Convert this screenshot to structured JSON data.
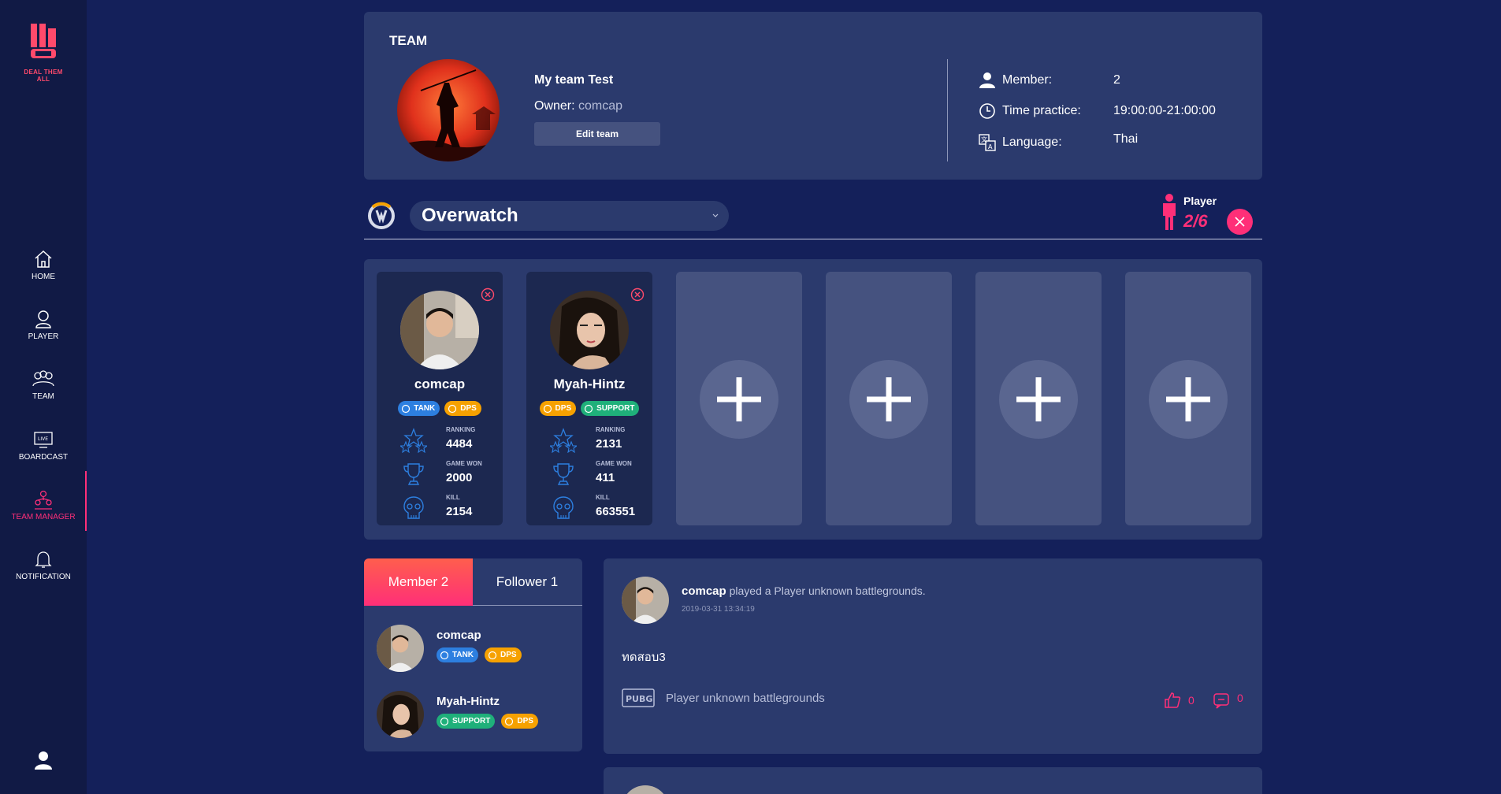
{
  "brand": {
    "name": "DEAL THEM ALL",
    "color": "#ff4a6b"
  },
  "sidebar": {
    "items": [
      {
        "label": "HOME",
        "icon": "home-icon"
      },
      {
        "label": "PLAYER",
        "icon": "player-icon"
      },
      {
        "label": "TEAM",
        "icon": "team-icon"
      },
      {
        "label": "BOARDCAST",
        "icon": "broadcast-icon"
      },
      {
        "label": "TEAM MANAGER",
        "icon": "team-manager-icon",
        "active": true
      },
      {
        "label": "NOTIFICATION",
        "icon": "bell-icon"
      }
    ],
    "profile_icon": "user-icon"
  },
  "team": {
    "heading": "TEAM",
    "name": "My team Test",
    "owner_label": "Owner:",
    "owner": "comcap",
    "edit_button": "Edit team",
    "info": {
      "member_label": "Member:",
      "member_value": "2",
      "time_label": "Time practice:",
      "time_value": "19:00:00-21:00:00",
      "language_label": "Language:",
      "language_value": "Thai"
    }
  },
  "game": {
    "name": "Overwatch",
    "player_label": "Player",
    "player_count": "2/6"
  },
  "roster": {
    "players": [
      {
        "name": "comcap",
        "roles": [
          {
            "label": "TANK",
            "type": "tank"
          },
          {
            "label": "DPS",
            "type": "dps"
          }
        ],
        "ranking_label": "RANKING",
        "ranking": "4484",
        "won_label": "GAME WON",
        "won": "2000",
        "kill_label": "KILL",
        "kill": "2154"
      },
      {
        "name": "Myah-Hintz",
        "roles": [
          {
            "label": "DPS",
            "type": "dps"
          },
          {
            "label": "SUPPORT",
            "type": "support"
          }
        ],
        "ranking_label": "RANKING",
        "ranking": "2131",
        "won_label": "GAME WON",
        "won": "411",
        "kill_label": "KILL",
        "kill": "663551"
      }
    ],
    "empty_slots": 4
  },
  "members_panel": {
    "tab_member": "Member 2",
    "tab_follower": "Follower 1",
    "members": [
      {
        "name": "comcap",
        "roles": [
          {
            "label": "TANK",
            "type": "tank"
          },
          {
            "label": "DPS",
            "type": "dps"
          }
        ]
      },
      {
        "name": "Myah-Hintz",
        "roles": [
          {
            "label": "SUPPORT",
            "type": "support"
          },
          {
            "label": "DPS",
            "type": "dps"
          }
        ]
      }
    ]
  },
  "feed": {
    "user": "comcap",
    "action": "played a Player unknown battlegrounds.",
    "time": "2019-03-31 13:34:19",
    "text": "ทดสอบ3",
    "game": "Player unknown battlegrounds",
    "likes": "0",
    "comments": "0"
  },
  "colors": {
    "accent": "#ff2f78",
    "background": "#14205a",
    "card": "#2b3a6d",
    "tank": "#2d7fe0",
    "dps": "#f6a100",
    "support": "#1fb07a"
  }
}
